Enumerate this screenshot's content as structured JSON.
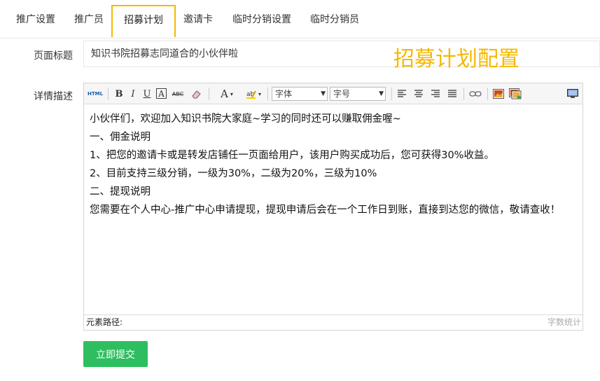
{
  "tabs": [
    {
      "label": "推广设置"
    },
    {
      "label": "推广员"
    },
    {
      "label": "招募计划",
      "active": true
    },
    {
      "label": "邀请卡"
    },
    {
      "label": "临时分销设置"
    },
    {
      "label": "临时分销员"
    }
  ],
  "form": {
    "title_label": "页面标题",
    "title_value": "知识书院招募志同道合的小伙伴啦",
    "overlay_title": "招募计划配置",
    "detail_label": "详情描述"
  },
  "editor": {
    "toolbar": {
      "html_label": "HTML",
      "bold": "B",
      "italic": "I",
      "underline": "U",
      "border_a": "A",
      "strike": "ABC",
      "font_color": "A",
      "font_family": "字体",
      "font_size": "字号",
      "icons": [
        "html-icon",
        "bold-icon",
        "italic-icon",
        "underline-icon",
        "border-icon",
        "strikethrough-icon",
        "eraser-icon",
        "font-color-icon",
        "highlight-icon",
        "align-left-icon",
        "align-center-icon",
        "align-right-icon",
        "justify-icon",
        "link-icon",
        "image-icon",
        "multi-image-icon",
        "fullscreen-icon"
      ]
    },
    "lines": [
      "小伙伴们，欢迎加入知识书院大家庭~学习的同时还可以赚取佣金喔~",
      "一、佣金说明",
      "1、把您的邀请卡或是转发店铺任一页面给用户，该用户购买成功后，您可获得30%收益。",
      "2、目前支持三级分销，一级为30%，二级为20%，三级为10%",
      "二、提现说明",
      "您需要在个人中心-推广中心申请提现，提现申请后会在一个工作日到账，直接到达您的微信，敬请查收！"
    ],
    "status_path": "元素路径:",
    "word_count": "字数统计"
  },
  "submit_label": "立即提交",
  "colors": {
    "accent": "#f5b800",
    "submit": "#2dbe60"
  }
}
